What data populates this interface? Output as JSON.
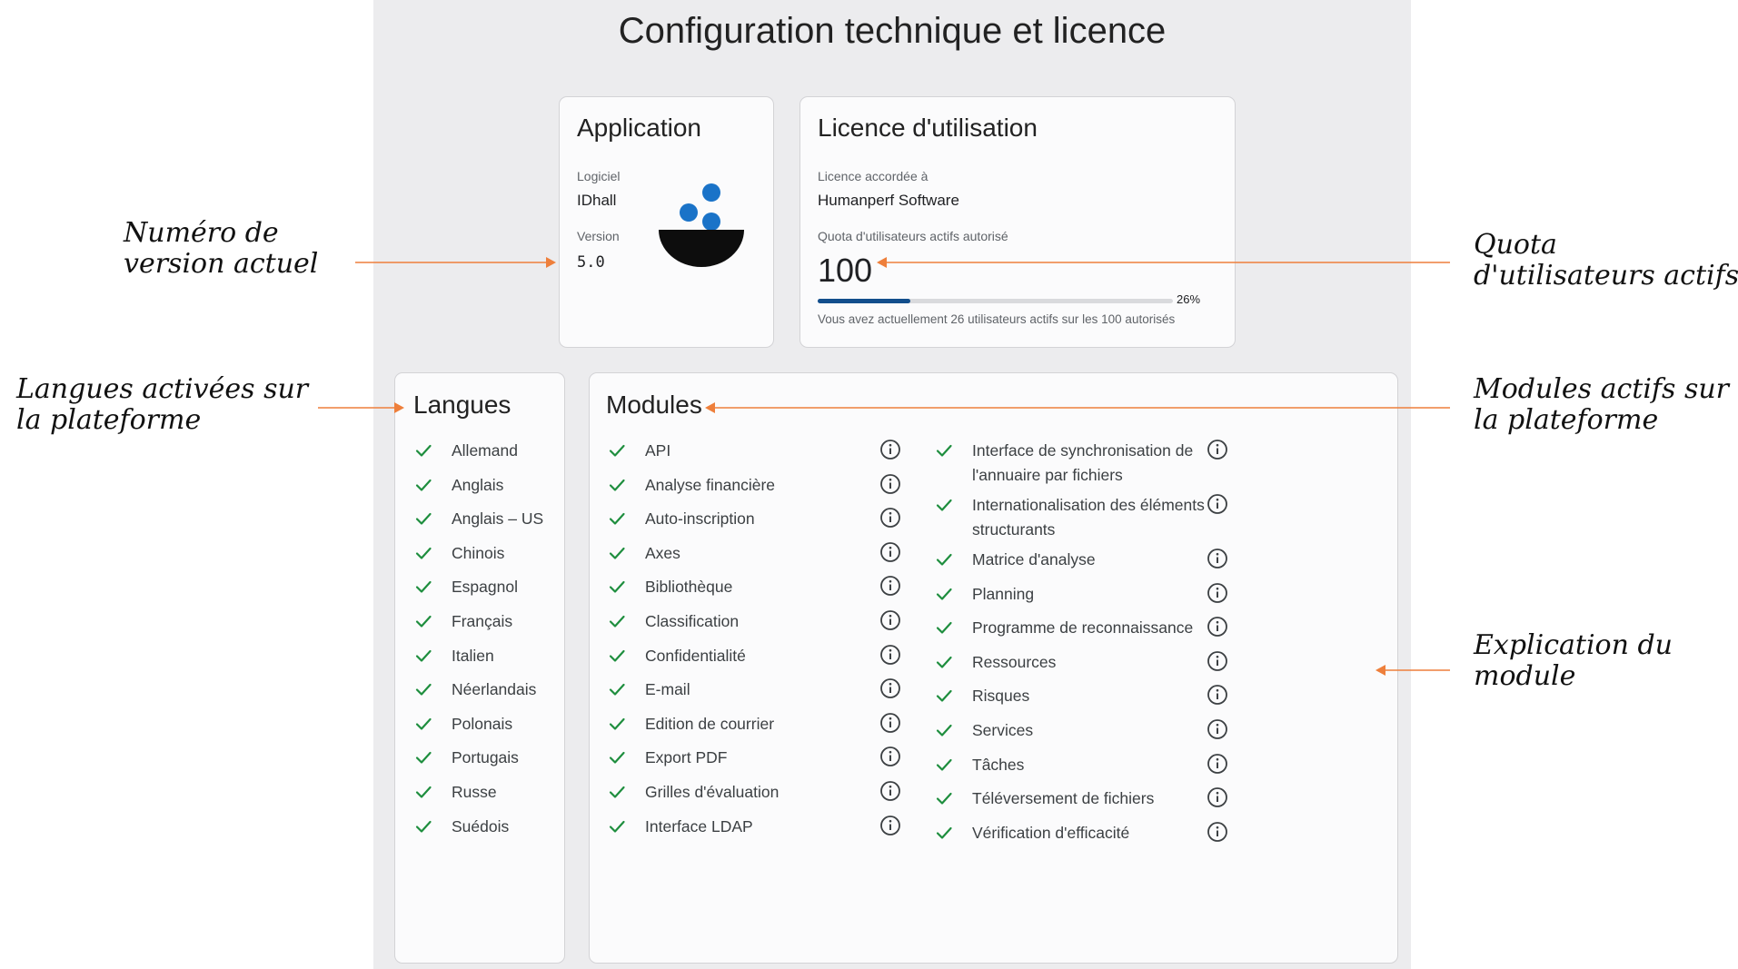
{
  "page_title": "Configuration technique et licence",
  "application": {
    "title": "Application",
    "software_label": "Logiciel",
    "software_value": "IDhall",
    "version_label": "Version",
    "version_value": "5.0"
  },
  "licence": {
    "title": "Licence d'utilisation",
    "granted_label": "Licence accordée à",
    "granted_value": "Humanperf Software",
    "quota_label": "Quota d'utilisateurs actifs autorisé",
    "quota_value": "100",
    "usage_fraction": 0.26,
    "usage_percent_label": "26%",
    "usage_note": "Vous avez actuellement 26 utilisateurs actifs sur les 100 autorisés"
  },
  "langues": {
    "title": "Langues",
    "items": [
      "Allemand",
      "Anglais",
      "Anglais – US",
      "Chinois",
      "Espagnol",
      "Français",
      "Italien",
      "Néerlandais",
      "Polonais",
      "Portugais",
      "Russe",
      "Suédois"
    ]
  },
  "modules": {
    "title": "Modules",
    "column_left": [
      "API",
      "Analyse financière",
      "Auto-inscription",
      "Axes",
      "Bibliothèque",
      "Classification",
      "Confidentialité",
      "E-mail",
      "Edition de courrier",
      "Export PDF",
      "Grilles d'évaluation",
      "Interface LDAP"
    ],
    "column_right": [
      "Interface de synchronisation de l'annuaire par fichiers",
      "Internationalisation des éléments structurants",
      "Matrice d'analyse",
      "Planning",
      "Programme de reconnaissance",
      "Ressources",
      "Risques",
      "Services",
      "Tâches",
      "Téléversement de fichiers",
      "Vérification d'efficacité"
    ]
  },
  "annotations": {
    "version": [
      "Numéro de",
      "version actuel"
    ],
    "quota": [
      "Quota",
      "d'utilisateurs actifs"
    ],
    "langues": [
      "Langues activées sur",
      "la plateforme"
    ],
    "modules": [
      "Modules actifs sur",
      "la plateforme"
    ],
    "explication": [
      "Explication du",
      "module"
    ]
  },
  "colors": {
    "check": "#1e8e3e",
    "progress": "#124e8c",
    "arrow": "#ee7f3b",
    "logo_blue": "#1a73c8"
  },
  "icons": {
    "check": "check-icon",
    "info": "info-icon",
    "logo": "idhall-logo"
  }
}
